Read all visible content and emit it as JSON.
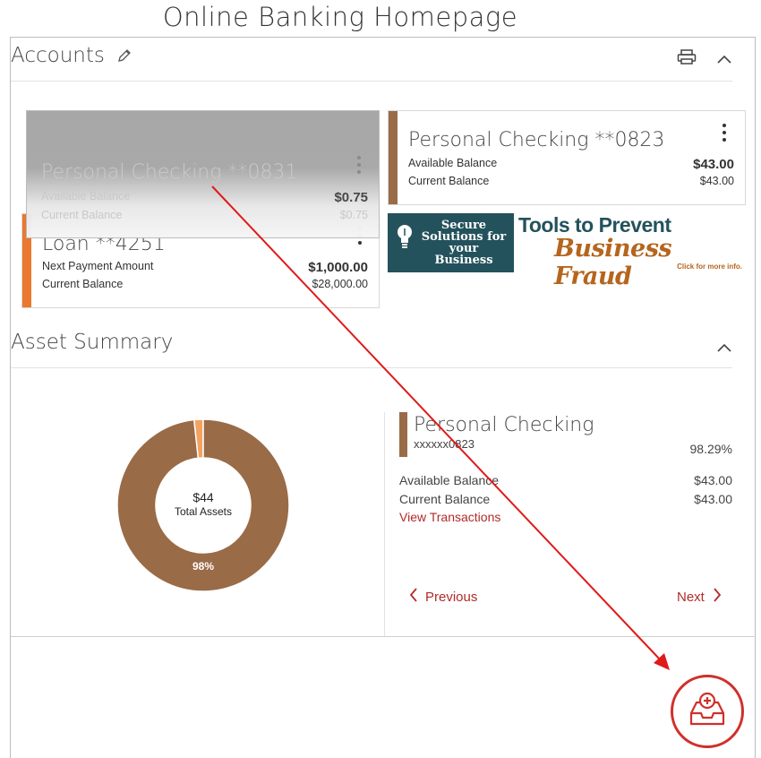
{
  "page_heading": "Online Banking Homepage",
  "accounts": {
    "title": "Accounts",
    "cards": [
      {
        "name": "Personal Checking **0823",
        "row1_label": "Available Balance",
        "row1_value": "$43.00",
        "row2_label": "Current Balance",
        "row2_value": "$43.00",
        "color": "#9a6b47"
      },
      {
        "name": "Loan **4251",
        "row1_label": "Next Payment Amount",
        "row1_value": "$1,000.00",
        "row2_label": "Current Balance",
        "row2_value": "$28,000.00",
        "color": "#e8792f"
      }
    ],
    "dragged_card": {
      "name": "Personal Checking **0831",
      "row1_label": "Available Balance",
      "row1_value": "$0.75",
      "row2_label": "Current Balance",
      "row2_value": "$0.75"
    }
  },
  "promo": {
    "box_text": "Secure Solutions for your Business",
    "title": "Tools to Prevent",
    "subtitle": "Business Fraud",
    "click": "Click for more info."
  },
  "asset_summary": {
    "title": "Asset Summary",
    "total_amount": "$44",
    "total_label": "Total Assets",
    "major_pct_label": "98%",
    "chart_data": {
      "type": "pie",
      "categories": [
        "Personal Checking **0823",
        "Personal Checking **0831"
      ],
      "values": [
        98.29,
        1.71
      ],
      "colors": [
        "#9a6b47",
        "#f4a261"
      ]
    },
    "detail": {
      "name": "Personal Checking",
      "mask": "xxxxxx0823",
      "pct": "98.29%",
      "avail_label": "Available Balance",
      "avail_value": "$43.00",
      "curr_label": "Current Balance",
      "curr_value": "$43.00",
      "link": "View Transactions"
    },
    "previous": "Previous",
    "next": "Next"
  }
}
